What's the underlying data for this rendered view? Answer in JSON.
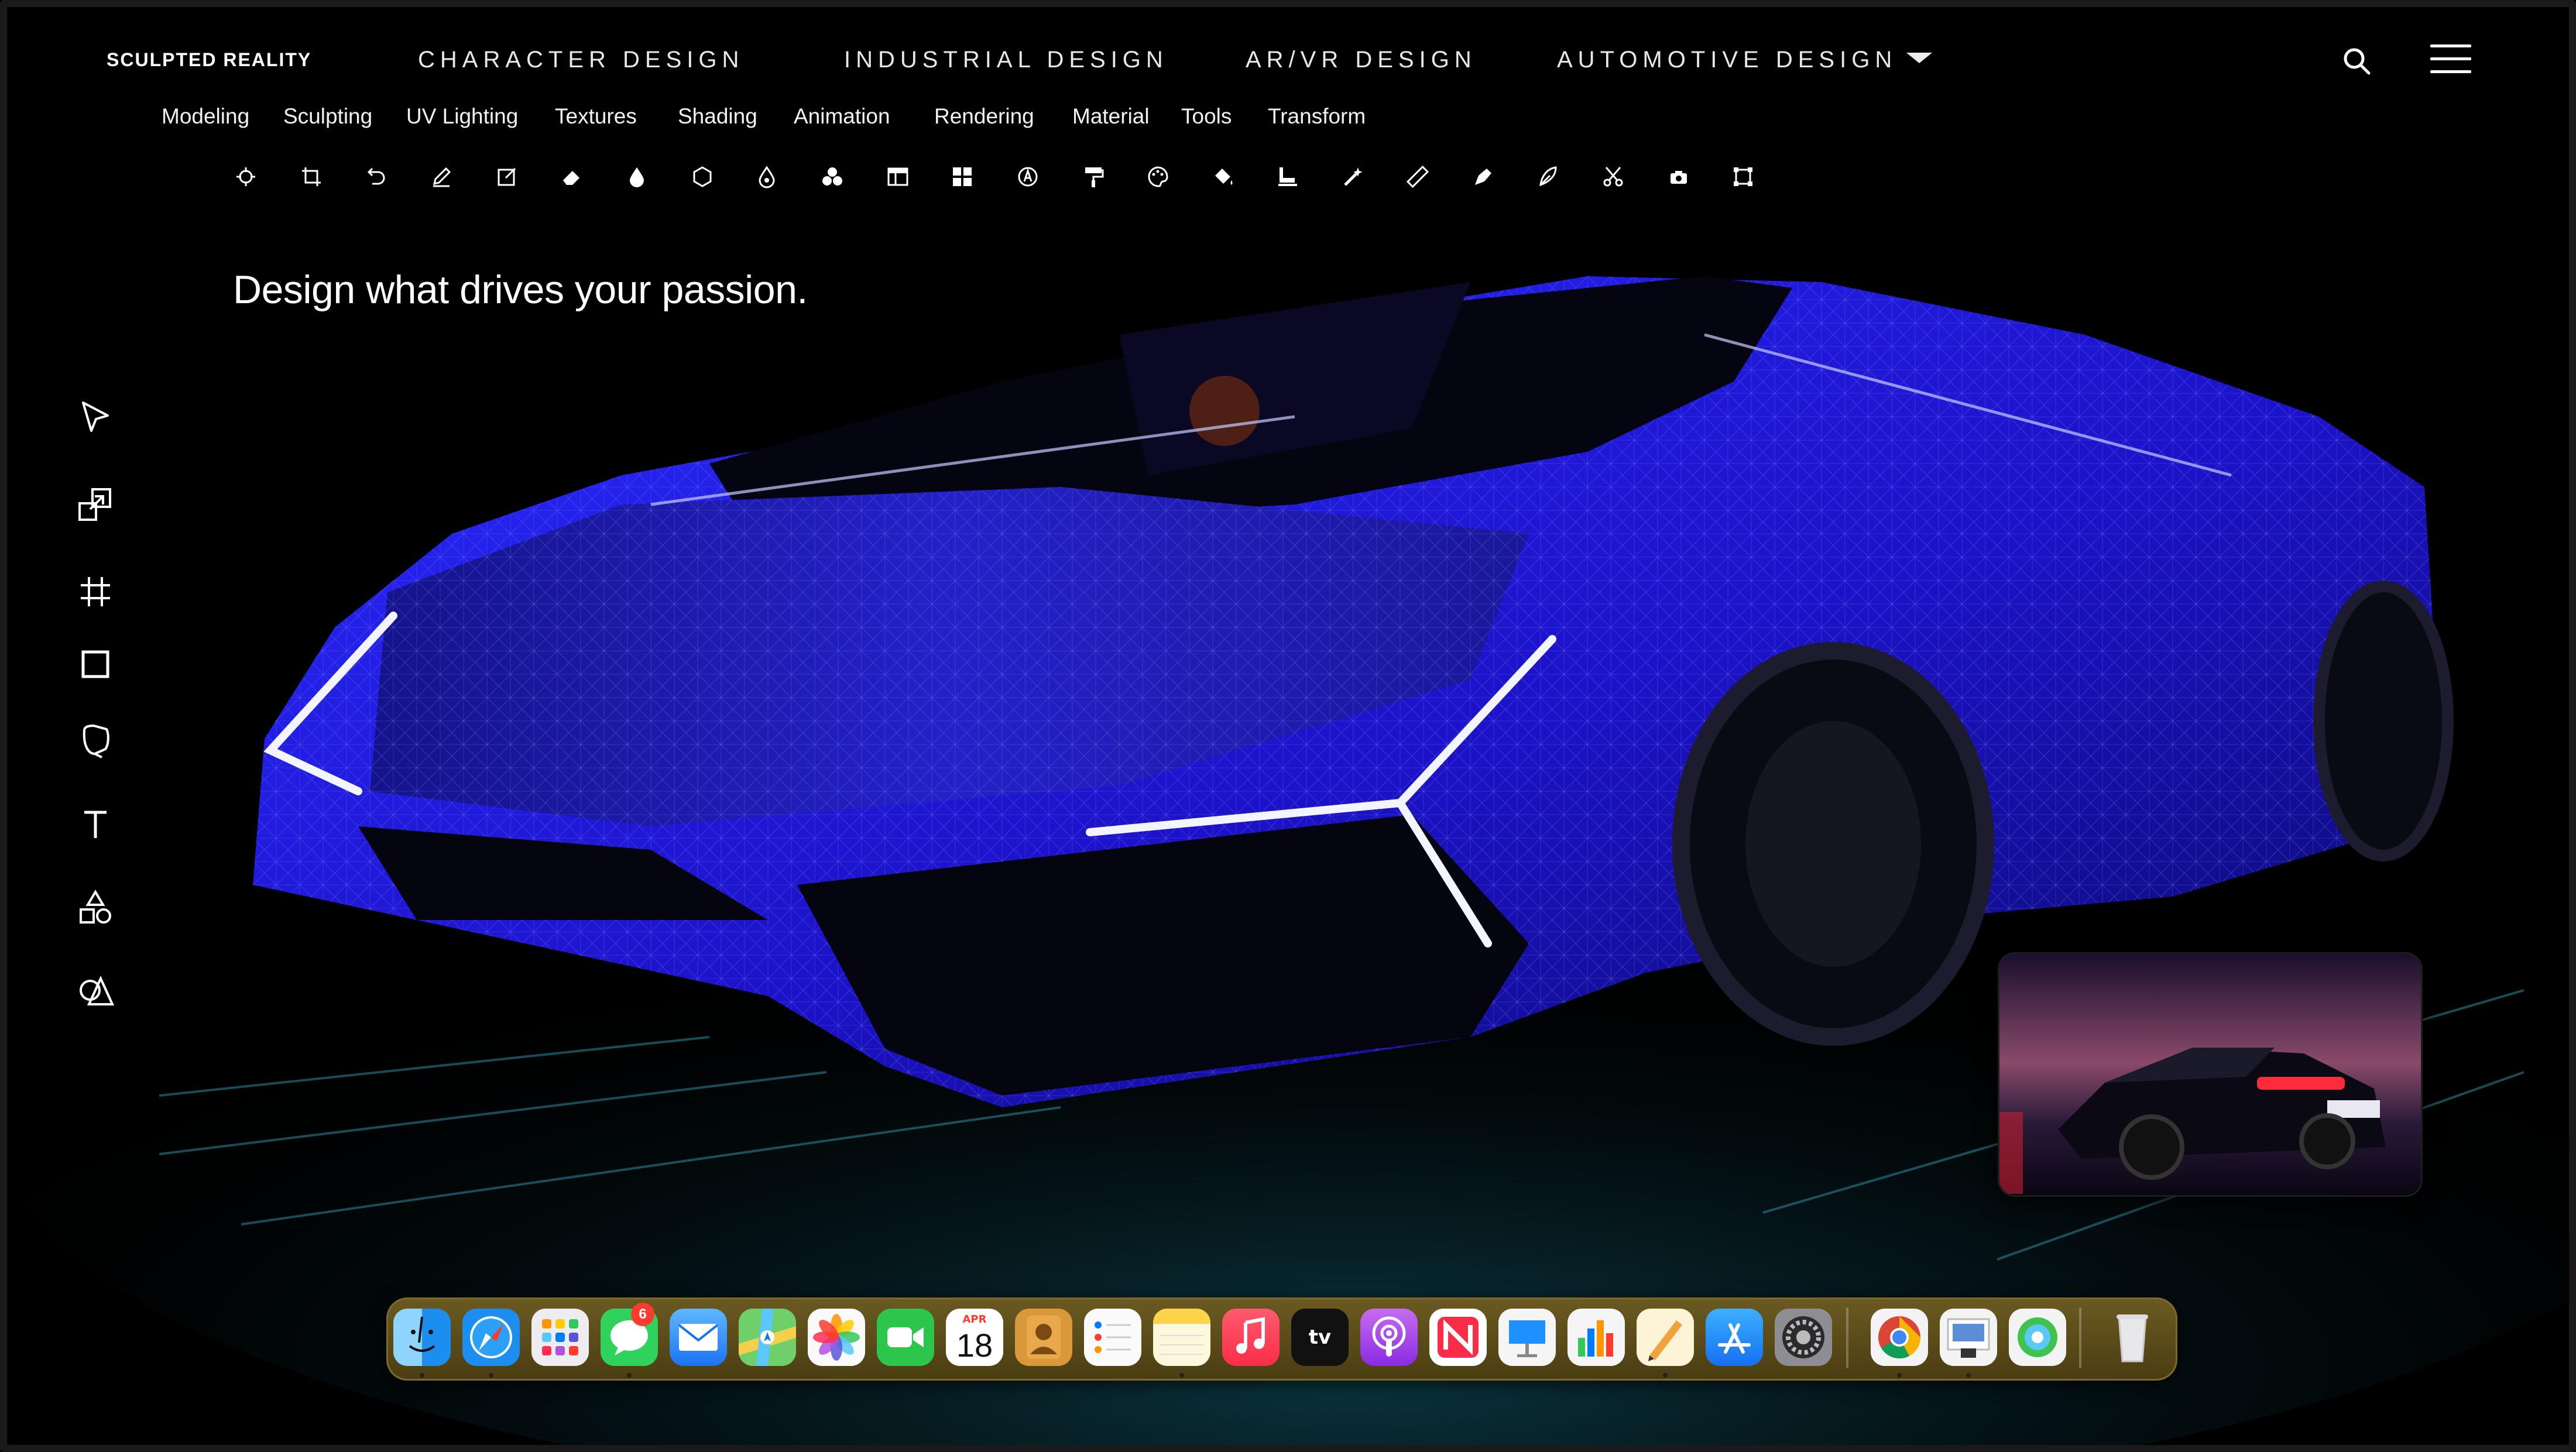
{
  "brand": "SCULPTED REALITY",
  "top_nav": [
    "CHARACTER DESIGN",
    "INDUSTRIAL DESIGN",
    "AR/VR DESIGN",
    "AUTOMOTIVE DESIGN"
  ],
  "top_icons": [
    "search-icon",
    "hamburger-menu-icon"
  ],
  "sub_nav": [
    "Modeling",
    "Sculpting",
    "UV Lighting",
    "Textures",
    "Shading",
    "Animation",
    "Rendering",
    "Material",
    "Tools",
    "Transform"
  ],
  "tool_icons": [
    "target-icon",
    "crop-icon",
    "undo-icon",
    "pen-icon",
    "edit-box-icon",
    "eraser-icon",
    "drop-icon",
    "hexagon-icon",
    "ink-drop-icon",
    "circles-icon",
    "layout-icon",
    "grid-icon",
    "compass-icon",
    "paint-roller-icon",
    "palette-icon",
    "fill-bucket-icon",
    "stamp-icon",
    "magic-wand-icon",
    "ruler-icon",
    "pen-nib-icon",
    "feather-icon",
    "scissors-icon",
    "camera-icon",
    "transform-box-icon"
  ],
  "tagline": "Design what drives your passion.",
  "left_tools": [
    "pointer-icon",
    "resize-icon",
    "frame-icon",
    "rectangle-icon",
    "lasso-icon",
    "text-icon",
    "shapes-icon",
    "shape-builder-icon"
  ],
  "dock": {
    "apps": [
      {
        "name": "finder",
        "color": "#2aa3f5"
      },
      {
        "name": "safari",
        "color": "#1c8ef0"
      },
      {
        "name": "launchpad",
        "color": "#e9e9ee"
      },
      {
        "name": "messages",
        "color": "#2fd35c"
      },
      {
        "name": "mail",
        "color": "#3a92f5"
      },
      {
        "name": "maps",
        "color": "#5dc15c"
      },
      {
        "name": "photos",
        "color": "#f5f5f5"
      },
      {
        "name": "facetime",
        "color": "#2bc64b"
      },
      {
        "name": "calendar",
        "color": "#ffffff"
      },
      {
        "name": "contacts",
        "color": "#d9983a"
      },
      {
        "name": "reminders",
        "color": "#fafafa"
      },
      {
        "name": "notes",
        "color": "#fbe77a"
      },
      {
        "name": "music",
        "color": "#fb3c57"
      },
      {
        "name": "tv",
        "color": "#111111"
      },
      {
        "name": "podcasts",
        "color": "#a64de8"
      },
      {
        "name": "news",
        "color": "#f7f7f7"
      },
      {
        "name": "keynote",
        "color": "#f4f4f4"
      },
      {
        "name": "numbers",
        "color": "#f4f4f4"
      },
      {
        "name": "pages",
        "color": "#f4f4f4"
      },
      {
        "name": "app-store",
        "color": "#1d8cf3"
      },
      {
        "name": "system-settings",
        "color": "#8d8d93"
      },
      {
        "name": "chrome",
        "color": "#f3f3f3"
      },
      {
        "name": "preview",
        "color": "#f3f3f3"
      },
      {
        "name": "find-my",
        "color": "#3fc34e"
      },
      {
        "name": "trash",
        "color": "#e5e5e5"
      }
    ],
    "messages_badge": "6",
    "calendar_month": "APR",
    "calendar_day": "18",
    "tv_label": "tv"
  }
}
